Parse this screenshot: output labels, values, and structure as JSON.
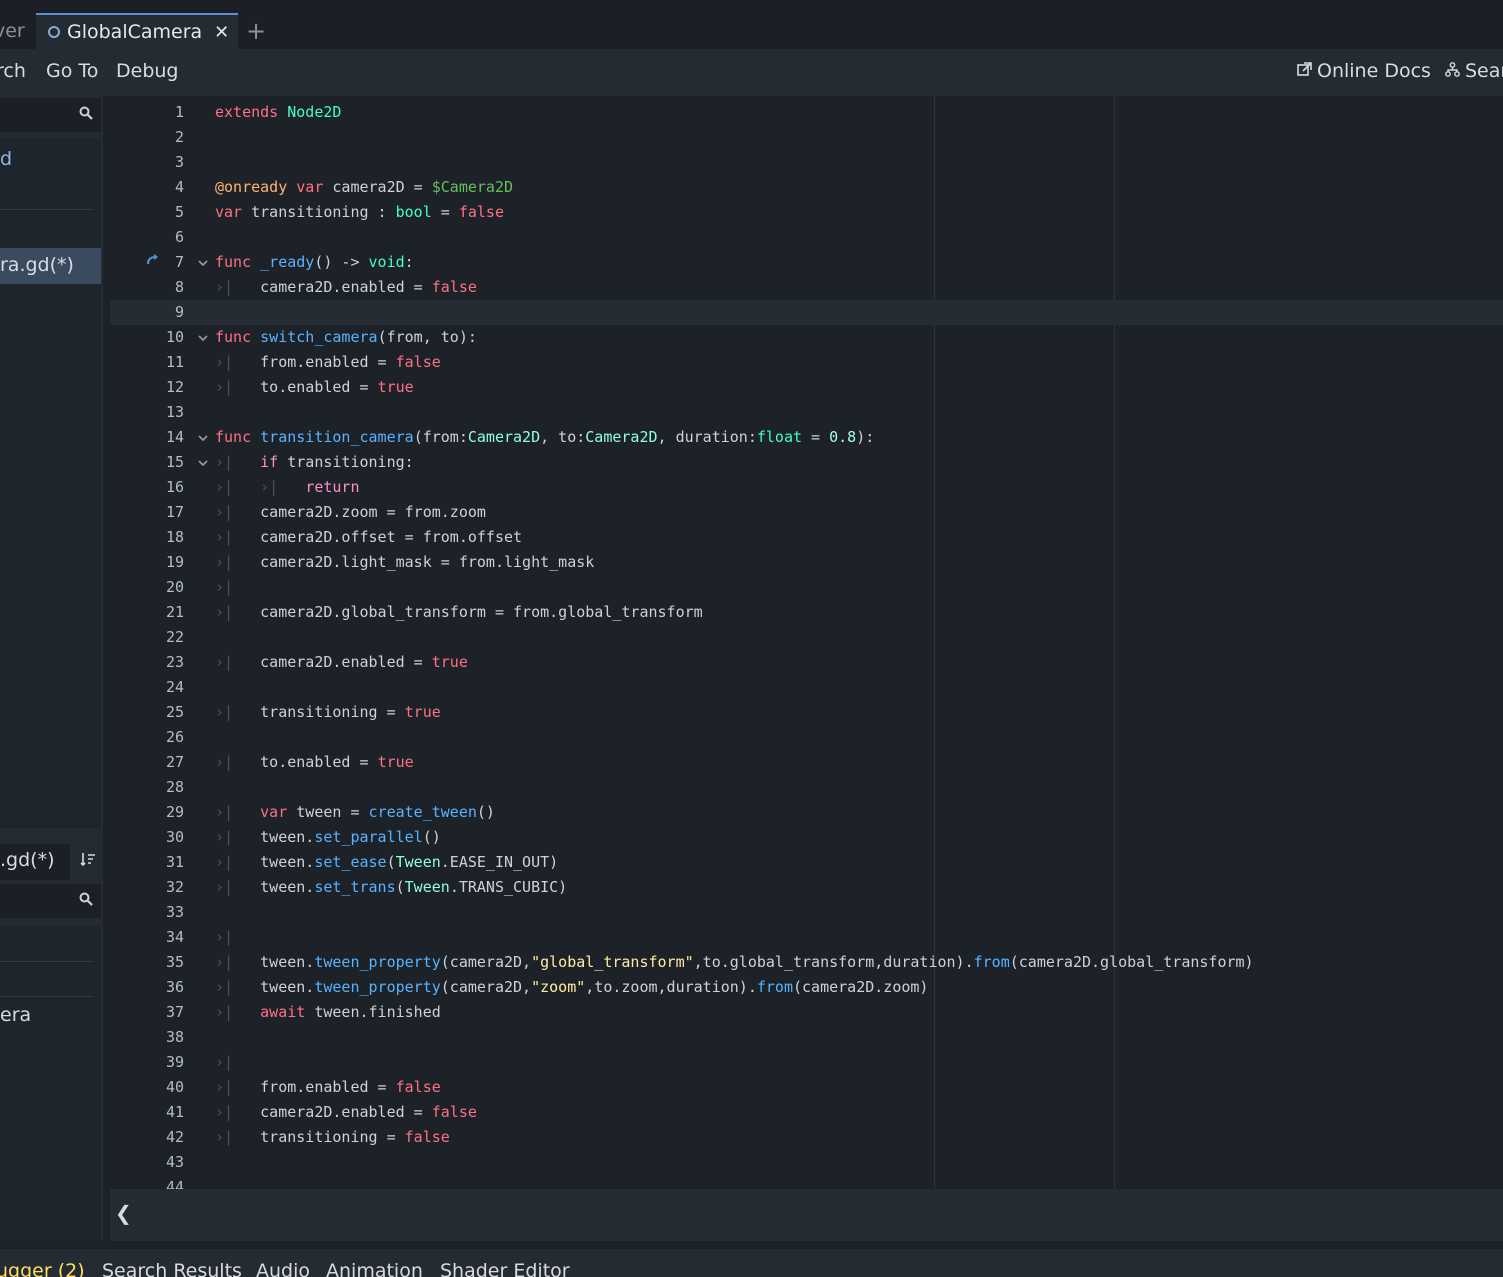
{
  "tabs": {
    "prev_label": "ver",
    "active_label": "GlobalCamera",
    "close_glyph": "✕",
    "add_glyph": "+"
  },
  "menu": {
    "items": [
      "rch",
      "Go To",
      "Debug"
    ],
    "online_docs": "Online Docs",
    "search_help": "Sear"
  },
  "left_panel": {
    "top_list": [
      "d",
      "ra.gd(*)"
    ],
    "footer_name": ".gd(*)",
    "bottom_list": [
      "era"
    ]
  },
  "code_lines": [
    "<span class=\"kw\">extends</span> <span class=\"ty\">Node2D</span>",
    "",
    "",
    "<span class=\"ann\">@onready</span> <span class=\"kw\">var</span> camera2D = <span class=\"node\">$Camera2D</span>",
    "<span class=\"kw\">var</span> transitioning : <span class=\"ty\">bool</span> = <span class=\"bool\">false</span>",
    "",
    "<span class=\"kw\">func</span> <span class=\"fn\">_ready</span>() -&gt; <span class=\"ty\">void</span>:",
    "<span class=\"tabmark\">›|</span>   camera2D.enabled = <span class=\"bool\">false</span>",
    "",
    "<span class=\"kw\">func</span> <span class=\"fn\">switch_camera</span>(from, to):",
    "<span class=\"tabmark\">›|</span>   from.enabled = <span class=\"bool\">false</span>",
    "<span class=\"tabmark\">›|</span>   to.enabled = <span class=\"bool\">true</span>",
    "",
    "<span class=\"kw\">func</span> <span class=\"fn\">transition_camera</span>(from:<span class=\"cls\">Camera2D</span>, to:<span class=\"cls\">Camera2D</span>, duration:<span class=\"ty\">float</span> = <span class=\"num\">0.8</span>):",
    "<span class=\"tabmark\">›|</span>   <span class=\"ctrl\">if</span> transitioning:",
    "<span class=\"tabmark\">›|</span>   <span class=\"tabmark\">›|</span>   <span class=\"ctrl\">return</span>",
    "<span class=\"tabmark\">›|</span>   camera2D.zoom = from.zoom",
    "<span class=\"tabmark\">›|</span>   camera2D.offset = from.offset",
    "<span class=\"tabmark\">›|</span>   camera2D.light_mask = from.light_mask",
    "<span class=\"tabmark\">›|</span>",
    "<span class=\"tabmark\">›|</span>   camera2D.global_transform = from.global_transform",
    "",
    "<span class=\"tabmark\">›|</span>   camera2D.enabled = <span class=\"bool\">true</span>",
    "",
    "<span class=\"tabmark\">›|</span>   transitioning = <span class=\"bool\">true</span>",
    "",
    "<span class=\"tabmark\">›|</span>   to.enabled = <span class=\"bool\">true</span>",
    "",
    "<span class=\"tabmark\">›|</span>   <span class=\"kw\">var</span> tween = <span class=\"fn\">create_tween</span>()",
    "<span class=\"tabmark\">›|</span>   tween.<span class=\"fn\">set_parallel</span>()",
    "<span class=\"tabmark\">›|</span>   tween.<span class=\"fn\">set_ease</span>(<span class=\"cls\">Tween</span>.EASE_IN_OUT)",
    "<span class=\"tabmark\">›|</span>   tween.<span class=\"fn\">set_trans</span>(<span class=\"cls\">Tween</span>.TRANS_CUBIC)",
    "",
    "<span class=\"tabmark\">›|</span>",
    "<span class=\"tabmark\">›|</span>   tween.<span class=\"fn\">tween_property</span>(camera2D,<span class=\"str\">\"global_transform\"</span>,to.global_transform,duration).<span class=\"fn\">from</span>(camera2D.global_transform)",
    "<span class=\"tabmark\">›|</span>   tween.<span class=\"fn\">tween_property</span>(camera2D,<span class=\"str\">\"zoom\"</span>,to.zoom,duration).<span class=\"fn\">from</span>(camera2D.zoom)",
    "<span class=\"tabmark\">›|</span>   <span class=\"kw\">await</span> tween.finished",
    "",
    "<span class=\"tabmark\">›|</span>",
    "<span class=\"tabmark\">›|</span>   from.enabled = <span class=\"bool\">false</span>",
    "<span class=\"tabmark\">›|</span>   camera2D.enabled = <span class=\"bool\">false</span>",
    "<span class=\"tabmark\">›|</span>   transitioning = <span class=\"bool\">false</span>",
    "",
    ""
  ],
  "fold_lines": [
    7,
    10,
    14,
    15
  ],
  "override_marker_line": 7,
  "current_line": 9,
  "bottom_tabs": [
    "ugger (2)",
    "Search Results",
    "Audio",
    "Animation",
    "Shader Editor"
  ]
}
